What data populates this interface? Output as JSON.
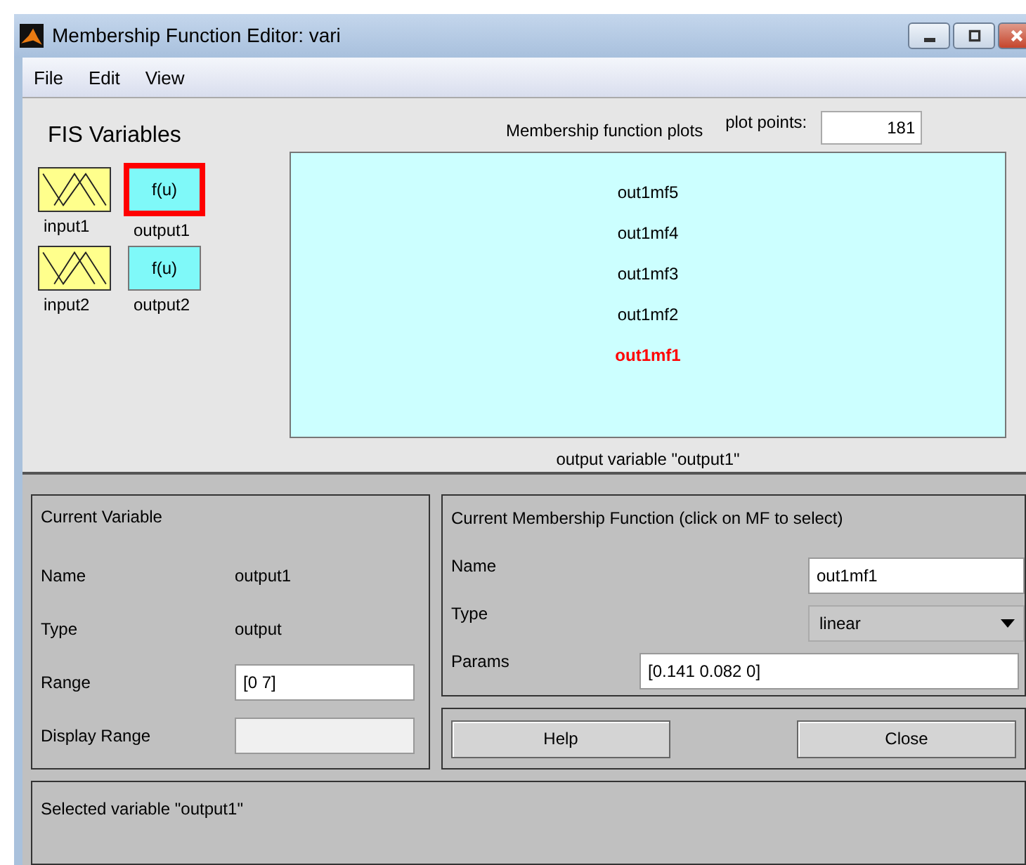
{
  "window": {
    "title": "Membership Function Editor: vari"
  },
  "menu": [
    "File",
    "Edit",
    "View"
  ],
  "fis_variables": {
    "title": "FIS Variables",
    "items": [
      {
        "name": "input1",
        "kind": "input",
        "selected": false
      },
      {
        "name": "output1",
        "kind": "output",
        "label": "f(u)",
        "selected": true
      },
      {
        "name": "input2",
        "kind": "input",
        "selected": false
      },
      {
        "name": "output2",
        "kind": "output",
        "label": "f(u)",
        "selected": false
      }
    ]
  },
  "plot": {
    "title": "Membership function plots",
    "plot_points_label": "plot points:",
    "plot_points": "181",
    "caption": "output variable \"output1\"",
    "mfs": [
      {
        "name": "out1mf5",
        "selected": false
      },
      {
        "name": "out1mf4",
        "selected": false
      },
      {
        "name": "out1mf3",
        "selected": false
      },
      {
        "name": "out1mf2",
        "selected": false
      },
      {
        "name": "out1mf1",
        "selected": true
      }
    ]
  },
  "current_variable": {
    "title": "Current Variable",
    "name_label": "Name",
    "name": "output1",
    "type_label": "Type",
    "type": "output",
    "range_label": "Range",
    "range": "[0 7]",
    "display_range_label": "Display Range",
    "display_range_disabled": true
  },
  "current_mf": {
    "title": "Current Membership Function (click on MF to select)",
    "name_label": "Name",
    "name": "out1mf1",
    "type_label": "Type",
    "type": "linear",
    "params_label": "Params",
    "params": "[0.141 0.082 0]"
  },
  "buttons": [
    "Help",
    "Close"
  ],
  "status": "Selected variable \"output1\""
}
